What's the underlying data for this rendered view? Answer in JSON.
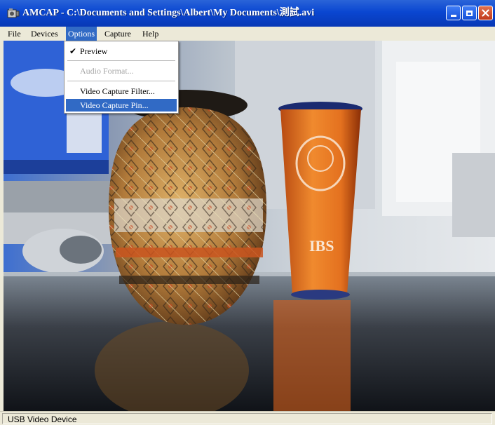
{
  "window": {
    "title": "AMCAP - C:\\Documents and Settings\\Albert\\My Documents\\測試.avi",
    "icon": "camera-app-icon",
    "colors": {
      "titlebar": "#0a46d1",
      "close_button": "#c1381a",
      "menu_highlight": "#316ac5"
    }
  },
  "menubar": {
    "items": [
      {
        "label": "File"
      },
      {
        "label": "Devices"
      },
      {
        "label": "Options"
      },
      {
        "label": "Capture"
      },
      {
        "label": "Help"
      }
    ],
    "active_index": 2
  },
  "options_menu": {
    "items": [
      {
        "label": "Preview",
        "checked": true,
        "enabled": true
      },
      {
        "label": "Audio Format...",
        "checked": false,
        "enabled": false
      },
      {
        "label": "Video Capture Filter...",
        "checked": false,
        "enabled": true
      },
      {
        "label": "Video Capture Pin...",
        "checked": false,
        "enabled": true,
        "selected": true
      }
    ]
  },
  "status": {
    "device": "USB Video Device"
  },
  "video": {
    "pot_mark": "IBS"
  }
}
